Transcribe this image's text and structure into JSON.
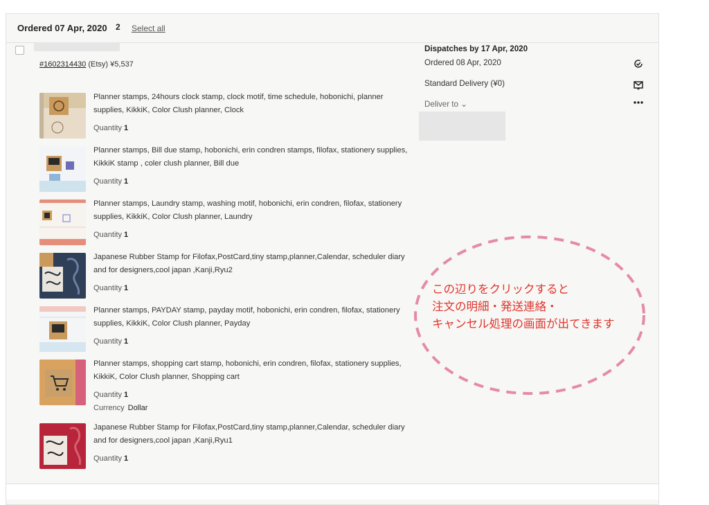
{
  "group": {
    "ordered_label": "Ordered 07 Apr, 2020",
    "count": "2",
    "select_all": "Select all"
  },
  "order": {
    "number": "#1602314430",
    "source": "(Etsy)",
    "total": "¥5,537"
  },
  "items": [
    {
      "title": "Planner stamps, 24hours clock stamp, clock motif, time schedule, hobonichi, planner supplies, KikkiK, Color Clush planner, Clock",
      "qty_label": "Quantity",
      "qty": "1"
    },
    {
      "title": "Planner stamps, Bill due stamp, hobonichi, erin condren stamps, filofax, stationery supplies, KikkiK stamp , coler clush planner, Bill due",
      "qty_label": "Quantity",
      "qty": "1"
    },
    {
      "title": "Planner stamps, Laundry stamp, washing motif, hobonichi, erin condren, filofax, stationery supplies, KikkiK, Color Clush planner, Laundry",
      "qty_label": "Quantity",
      "qty": "1"
    },
    {
      "title": "Japanese Rubber Stamp for Filofax,PostCard,tiny stamp,planner,Calendar, scheduler diary and for designers,cool japan ,Kanji,Ryu2",
      "qty_label": "Quantity",
      "qty": "1"
    },
    {
      "title": "Planner stamps, PAYDAY stamp, payday motif, hobonichi, erin condren, filofax, stationery supplies, KikkiK, Color Clush planner, Payday",
      "qty_label": "Quantity",
      "qty": "1"
    },
    {
      "title": "Planner stamps, shopping cart stamp, hobonichi, erin condren, filofax, stationery supplies, KikkiK, Color Clush planner, Shopping cart",
      "qty_label": "Quantity",
      "qty": "1",
      "currency_label": "Currency",
      "currency": "Dollar"
    },
    {
      "title": "Japanese Rubber Stamp for Filofax,PostCard,tiny stamp,planner,Calendar, scheduler diary and for designers,cool japan ,Kanji,Ryu1",
      "qty_label": "Quantity",
      "qty": "1"
    }
  ],
  "shipping": {
    "dispatch": "Dispatches by 17 Apr, 2020",
    "ordered": "Ordered 08 Apr, 2020",
    "delivery": "Standard Delivery (¥0)",
    "deliver_to": "Deliver to ⌄"
  },
  "icons": {
    "complete": "check-clock-icon",
    "message": "message-icon",
    "more": "more-dots-icon"
  },
  "annotation": {
    "line1": "この辺りをクリックすると",
    "line2": "注文の明細・発送連絡・",
    "line3": "キャンセル処理の画面が出てきます",
    "color": "#e0342c",
    "ellipse_color": "#e58aa8"
  }
}
